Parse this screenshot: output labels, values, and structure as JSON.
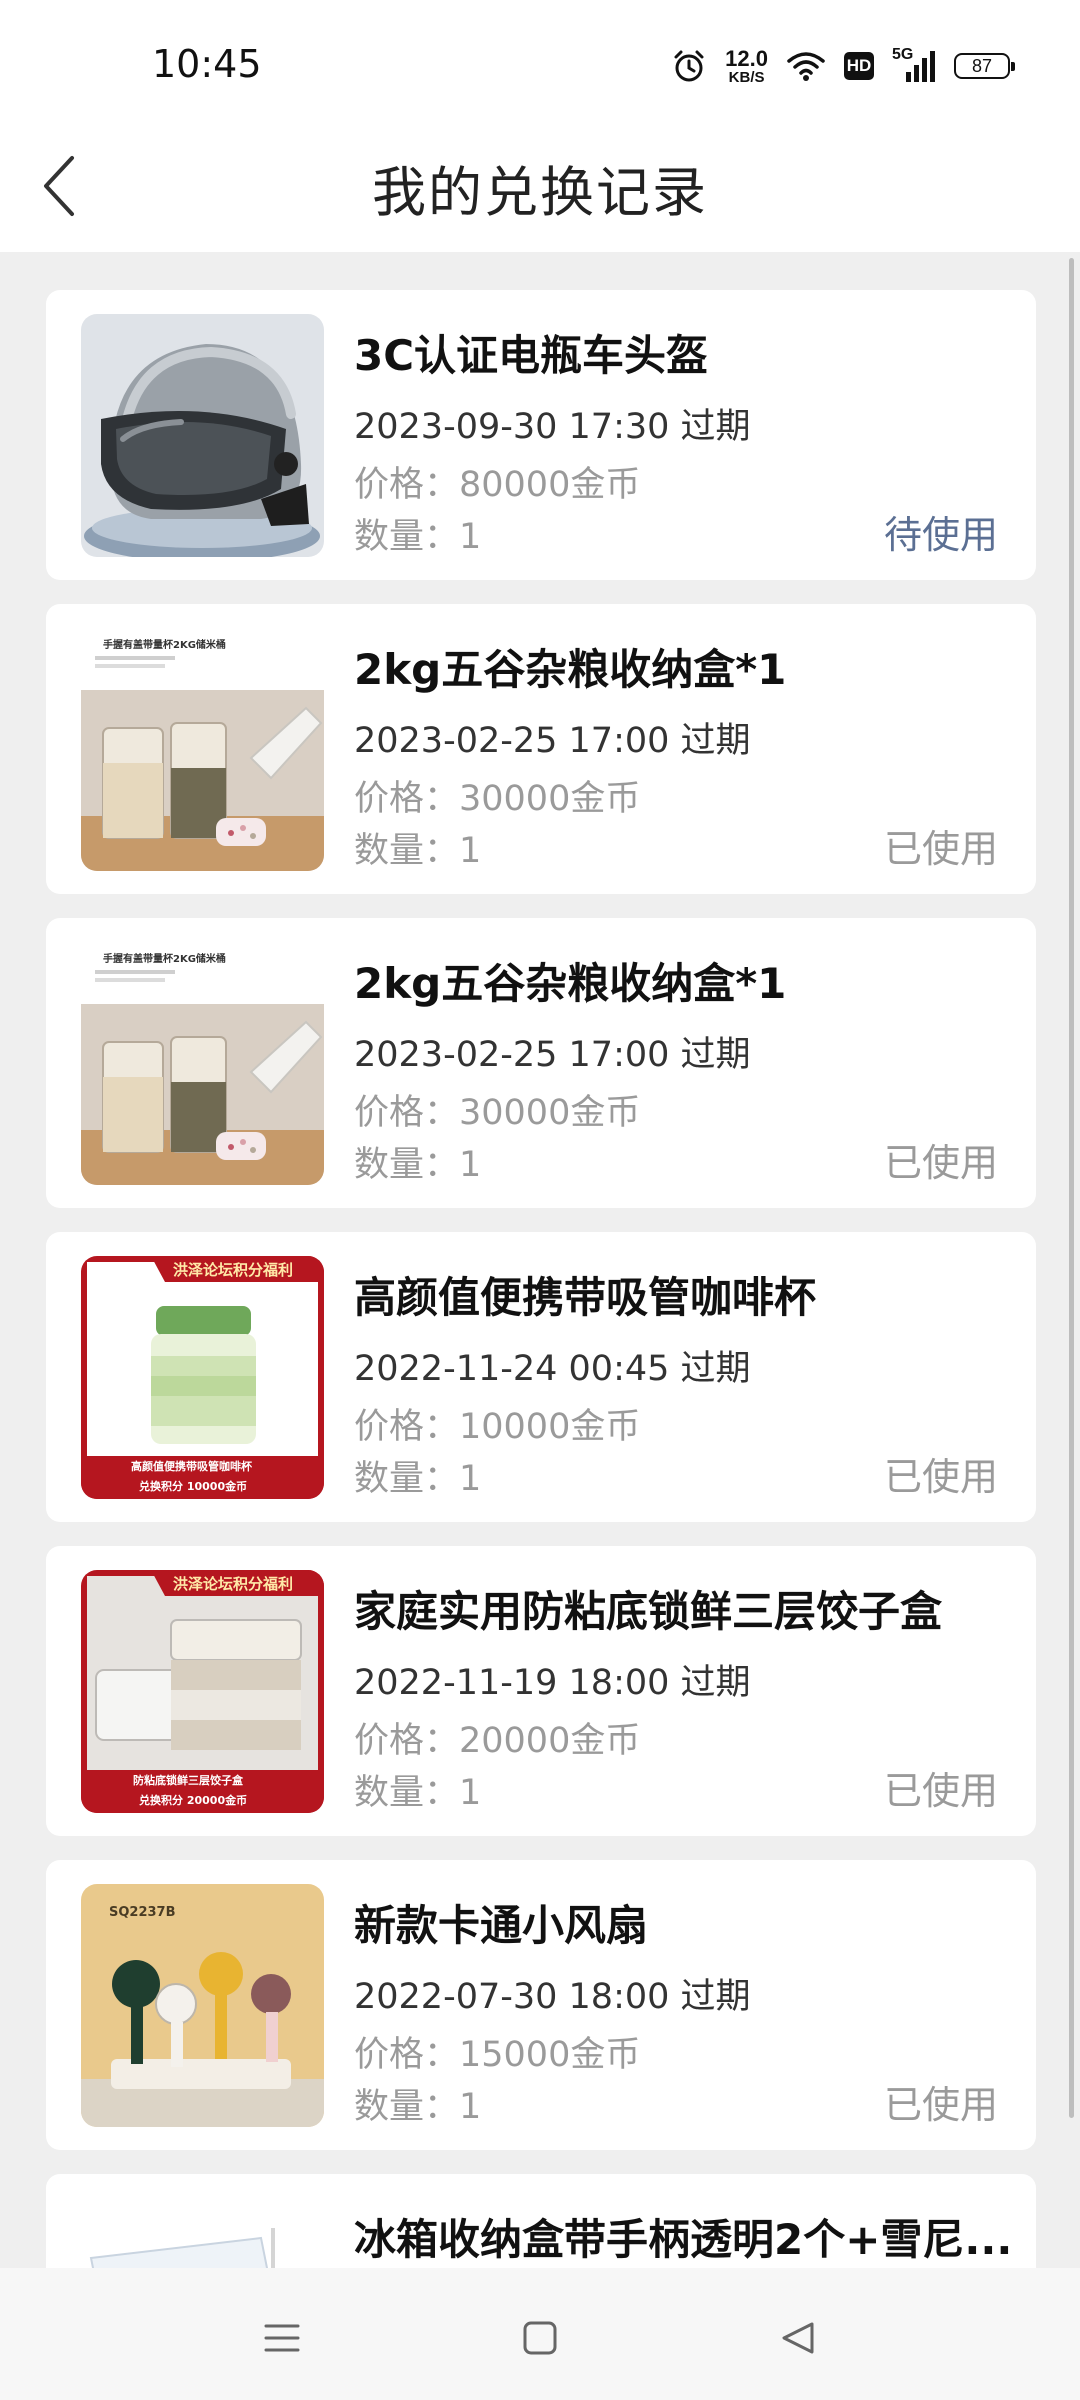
{
  "status_bar": {
    "time": "10:45",
    "net_speed_value": "12.0",
    "net_speed_unit": "KB/S",
    "hd": "HD",
    "network": "5G",
    "battery": "87",
    "icons": [
      "alarm-icon",
      "wifi-icon",
      "hd-icon",
      "signal-icon",
      "battery-icon"
    ]
  },
  "header": {
    "title": "我的兑换记录",
    "back_icon": "chevron-left-icon"
  },
  "records": [
    {
      "image": "helmet",
      "title": "3C认证电瓶车头盔",
      "expire": "2023-09-30 17:30 过期",
      "price": "价格：80000金币",
      "qty": "数量：1",
      "status": "待使用",
      "pending": true
    },
    {
      "image": "grain-box",
      "image_caption": "手握有盖带量杯2KG储米桶",
      "title": "2kg五谷杂粮收纳盒*1",
      "expire": "2023-02-25 17:00 过期",
      "price": "价格：30000金币",
      "qty": "数量：1",
      "status": "已使用",
      "pending": false
    },
    {
      "image": "grain-box",
      "image_caption": "手握有盖带量杯2KG储米桶",
      "title": "2kg五谷杂粮收纳盒*1",
      "expire": "2023-02-25 17:00 过期",
      "price": "价格：30000金币",
      "qty": "数量：1",
      "status": "已使用",
      "pending": false
    },
    {
      "image": "coffee-cup",
      "image_banner": "洪泽论坛积分福利",
      "image_caption": "高颜值便携带吸管咖啡杯",
      "image_footer": "兑换积分  10000金币",
      "title": "高颜值便携带吸管咖啡杯",
      "expire": "2022-11-24 00:45 过期",
      "price": "价格：10000金币",
      "qty": "数量：1",
      "status": "已使用",
      "pending": false
    },
    {
      "image": "dumpling-box",
      "image_banner": "洪泽论坛积分福利",
      "image_caption": "防粘底锁鲜三层饺子盒",
      "image_footer": "兑换积分  20000金币",
      "title": "家庭实用防粘底锁鲜三层饺子盒",
      "expire": "2022-11-19 18:00 过期",
      "price": "价格：20000金币",
      "qty": "数量：1",
      "status": "已使用",
      "pending": false
    },
    {
      "image": "fan",
      "image_caption": "SQ2237B",
      "title": "新款卡通小风扇",
      "expire": "2022-07-30 18:00 过期",
      "price": "价格：15000金币",
      "qty": "数量：1",
      "status": "已使用",
      "pending": false
    },
    {
      "image": "fridge-box",
      "title": "冰箱收纳盒带手柄透明2个+雪尼...",
      "expire": "",
      "price": "",
      "qty": "",
      "status": "",
      "pending": false
    }
  ],
  "nav_bar": {
    "icons": [
      "menu-icon",
      "home-icon",
      "back-icon"
    ]
  }
}
